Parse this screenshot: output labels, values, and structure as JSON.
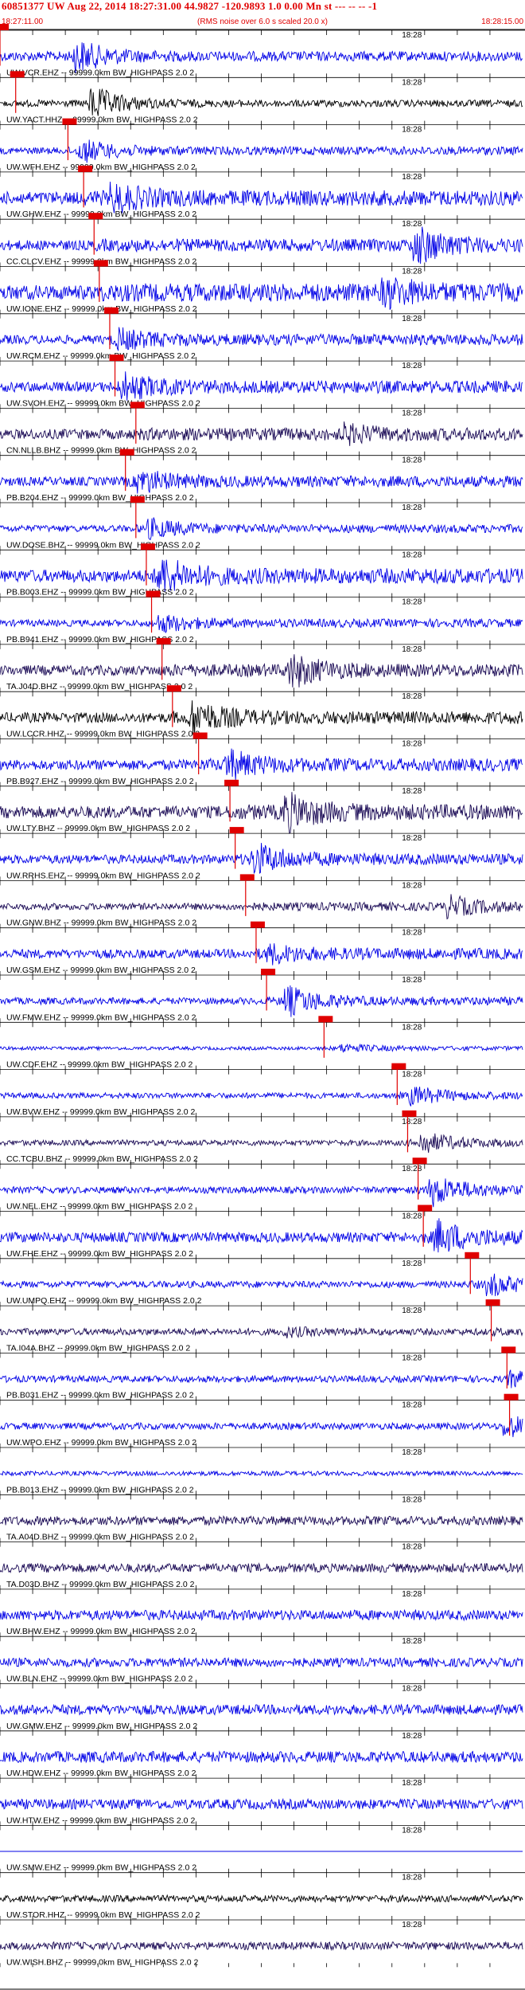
{
  "header": {
    "title": "60851377 UW Aug 22, 2014 18:27:31.00   44.9827 -120.9893  1.0 0.00 Mn st --- -- --  -1",
    "time_start": "18:27:11.00",
    "rms_note": "(RMS noise over 6.0 s scaled 20.0 x)",
    "time_end": "18:28:15.00"
  },
  "colors": {
    "trace_blue": "#0000e6",
    "trace_dark": "#1a0a55",
    "trace_black": "#000000",
    "pick_red": "#e00000",
    "grid": "#000000"
  },
  "tick_label": "18:28",
  "traces": [
    {
      "label": "UW.VCR.EHZ -- 99999.0km BW_HIGHPASS  2.0  2",
      "color": "blue",
      "amp": 0.35,
      "pick": 0.0,
      "burst": 0.15,
      "burst_amp": 1.2
    },
    {
      "label": "UW.YACT.HHZ -- 99999.0km BW_HIGHPASS  2.0  2",
      "color": "black",
      "amp": 0.25,
      "pick": 0.03,
      "burst": 0.18,
      "burst_amp": 1.3
    },
    {
      "label": "UW.WFH.EHZ -- 99999.0km BW_HIGHPASS  2.0  2",
      "color": "blue",
      "amp": 0.3,
      "pick": 0.13,
      "burst": 0.16,
      "burst_amp": 0.8
    },
    {
      "label": "UW.GHW.EHZ -- 99999.0km BW_HIGHPASS  2.0  2",
      "color": "blue",
      "amp": 0.55,
      "pick": 0.16,
      "burst": 0.22,
      "burst_amp": 0.9
    },
    {
      "label": "CC.CLCV.EHZ -- 99999.0km BW_HIGHPASS  2.0  2",
      "color": "blue",
      "amp": 0.45,
      "pick": 0.18,
      "burst": 0.8,
      "burst_amp": 1.4
    },
    {
      "label": "UW.IONE.EHZ -- 99999.0km BW_HIGHPASS  2.0  2",
      "color": "blue",
      "amp": 0.65,
      "pick": 0.19,
      "burst": 0.74,
      "burst_amp": 0.9
    },
    {
      "label": "UW.RCM.EHZ -- 99999.0km BW_HIGHPASS  2.0  2",
      "color": "blue",
      "amp": 0.4,
      "pick": 0.21,
      "burst": 0.23,
      "burst_amp": 0.7
    },
    {
      "label": "UW.SVOH.EHZ -- 99999.0km BW_HIGHPASS  2.0  2",
      "color": "blue",
      "amp": 0.45,
      "pick": 0.22,
      "burst": 0.24,
      "burst_amp": 0.9
    },
    {
      "label": "CN.NLLB.BHZ -- 99999.0km BW_HIGHPASS  2.0  2",
      "color": "dark",
      "amp": 0.45,
      "pick": 0.26,
      "burst": 0.66,
      "burst_amp": 0.6
    },
    {
      "label": "PB.B204.EHZ -- 99999.0km BW_HIGHPASS  2.0  2",
      "color": "blue",
      "amp": 0.4,
      "pick": 0.24,
      "burst": 0.27,
      "burst_amp": 0.8
    },
    {
      "label": "UW.DOSE.BHZ -- 99999.0km BW_HIGHPASS  2.0  2",
      "color": "blue",
      "amp": 0.3,
      "pick": 0.26,
      "burst": 0.29,
      "burst_amp": 0.7
    },
    {
      "label": "PB.B003.EHZ -- 99999.0km BW_HIGHPASS  2.0  2",
      "color": "blue",
      "amp": 0.55,
      "pick": 0.28,
      "burst": 0.31,
      "burst_amp": 1.3
    },
    {
      "label": "PB.B941.EHZ -- 99999.0km BW_HIGHPASS  2.0  2",
      "color": "blue",
      "amp": 0.3,
      "pick": 0.29,
      "burst": 0.31,
      "burst_amp": 0.6
    },
    {
      "label": "TA.J04D.BHZ -- 99999.0km BW_HIGHPASS  2.0  2",
      "color": "dark",
      "amp": 0.45,
      "pick": 0.31,
      "burst": 0.56,
      "burst_amp": 1.2
    },
    {
      "label": "UW.LCCR.HHZ -- 99999.0km BW_HIGHPASS  2.0  2",
      "color": "black",
      "amp": 0.45,
      "pick": 0.33,
      "burst": 0.37,
      "burst_amp": 1.3
    },
    {
      "label": "PB.B927.EHZ -- 99999.0km BW_HIGHPASS  2.0  2",
      "color": "blue",
      "amp": 0.45,
      "pick": 0.38,
      "burst": 0.44,
      "burst_amp": 1.0
    },
    {
      "label": "UW.LTY.BHZ -- 99999.0km BW_HIGHPASS  2.0  2",
      "color": "dark",
      "amp": 0.55,
      "pick": 0.44,
      "burst": 0.55,
      "burst_amp": 1.3
    },
    {
      "label": "UW.RRHS.EHZ -- 99999.0km BW_HIGHPASS  2.0  2",
      "color": "blue",
      "amp": 0.4,
      "pick": 0.45,
      "burst": 0.49,
      "burst_amp": 1.2
    },
    {
      "label": "UW.GNW.BHZ -- 99999.0km BW_HIGHPASS  2.0  2",
      "color": "dark",
      "amp": 0.3,
      "pick": 0.47,
      "burst": 0.86,
      "burst_amp": 0.8
    },
    {
      "label": "UW.GSM.EHZ -- 99999.0km BW_HIGHPASS  2.0  2",
      "color": "blue",
      "amp": 0.4,
      "pick": 0.49,
      "burst": 0.52,
      "burst_amp": 0.6
    },
    {
      "label": "UW.FMW.EHZ -- 99999.0km BW_HIGHPASS  2.0  2",
      "color": "blue",
      "amp": 0.3,
      "pick": 0.51,
      "burst": 0.55,
      "burst_amp": 1.2
    },
    {
      "label": "UW.CDF.EHZ -- 99999.0km BW_HIGHPASS  2.0  2",
      "color": "blue",
      "amp": 0.15,
      "pick": 0.62,
      "burst": 0.66,
      "burst_amp": 0.3
    },
    {
      "label": "UW.BVW.EHZ -- 99999.0km BW_HIGHPASS  2.0  2",
      "color": "blue",
      "amp": 0.25,
      "pick": 0.76,
      "burst": 0.79,
      "burst_amp": 0.7
    },
    {
      "label": "CC.TCBU.BHZ -- 99999.0km BW_HIGHPASS  2.0  2",
      "color": "dark",
      "amp": 0.25,
      "pick": 0.78,
      "burst": 0.81,
      "burst_amp": 0.8
    },
    {
      "label": "UW.NEL.EHZ -- 99999.0km BW_HIGHPASS  2.0  2",
      "color": "blue",
      "amp": 0.3,
      "pick": 0.8,
      "burst": 0.83,
      "burst_amp": 1.2
    },
    {
      "label": "UW.FHE.EHZ -- 99999.0km BW_HIGHPASS  2.0  2",
      "color": "blue",
      "amp": 0.45,
      "pick": 0.81,
      "burst": 0.84,
      "burst_amp": 1.2
    },
    {
      "label": "UW.UMPQ.EHZ -- 99999.0km BW_HIGHPASS  2.0  2",
      "color": "blue",
      "amp": 0.3,
      "pick": 0.9,
      "burst": 0.94,
      "burst_amp": 0.8
    },
    {
      "label": "TA.I04A.BHZ -- 99999.0km BW_HIGHPASS  2.0  2",
      "color": "dark",
      "amp": 0.3,
      "pick": 0.94,
      "burst": 0.55,
      "burst_amp": 0.3
    },
    {
      "label": "PB.B031.EHZ -- 99999.0km BW_HIGHPASS  2.0  2",
      "color": "blue",
      "amp": 0.3,
      "pick": 0.97,
      "burst": 0.98,
      "burst_amp": 0.5
    },
    {
      "label": "UW.WPO.EHZ -- 99999.0km BW_HIGHPASS  2.0  2",
      "color": "blue",
      "amp": 0.3,
      "pick": 0.975,
      "burst": 0.97,
      "burst_amp": 0.8
    },
    {
      "label": "PB.B013.EHZ -- 99999.0km BW_HIGHPASS  2.0  2",
      "color": "blue",
      "amp": 0.2,
      "pick": null,
      "burst": null,
      "burst_amp": 0
    },
    {
      "label": "TA.A04D.BHZ -- 99999.0km BW_HIGHPASS  2.0  2",
      "color": "dark",
      "amp": 0.4,
      "pick": null,
      "burst": null,
      "burst_amp": 0
    },
    {
      "label": "TA.D03D.BHZ -- 99999.0km BW_HIGHPASS  2.0  2",
      "color": "dark",
      "amp": 0.4,
      "pick": null,
      "burst": null,
      "burst_amp": 0
    },
    {
      "label": "UW.BHW.EHZ -- 99999.0km BW_HIGHPASS  2.0  2",
      "color": "blue",
      "amp": 0.45,
      "pick": null,
      "burst": null,
      "burst_amp": 0
    },
    {
      "label": "UW.BLN.EHZ -- 99999.0km BW_HIGHPASS  2.0  2",
      "color": "blue",
      "amp": 0.4,
      "pick": null,
      "burst": null,
      "burst_amp": 0
    },
    {
      "label": "UW.GMW.EHZ -- 99999.0km BW_HIGHPASS  2.0  2",
      "color": "blue",
      "amp": 0.45,
      "pick": null,
      "burst": null,
      "burst_amp": 0
    },
    {
      "label": "UW.HDW.EHZ -- 99999.0km BW_HIGHPASS  2.0  2",
      "color": "blue",
      "amp": 0.5,
      "pick": null,
      "burst": null,
      "burst_amp": 0
    },
    {
      "label": "UW.HTW.EHZ -- 99999.0km BW_HIGHPASS  2.0  2",
      "color": "blue",
      "amp": 0.45,
      "pick": null,
      "burst": null,
      "burst_amp": 0
    },
    {
      "label": "UW.SMW.EHZ -- 99999.0km BW_HIGHPASS  2.0  2",
      "color": "blue",
      "amp": 0.0,
      "pick": null,
      "burst": null,
      "burst_amp": 0
    },
    {
      "label": "UW.STOR.HHZ -- 99999.0km BW_HIGHPASS  2.0  2",
      "color": "black",
      "amp": 0.3,
      "pick": null,
      "burst": null,
      "burst_amp": 0
    },
    {
      "label": "UW.WISH.BHZ -- 99999.0km BW_HIGHPASS  2.0  2",
      "color": "dark",
      "amp": 0.35,
      "pick": null,
      "burst": null,
      "burst_amp": 0
    }
  ]
}
